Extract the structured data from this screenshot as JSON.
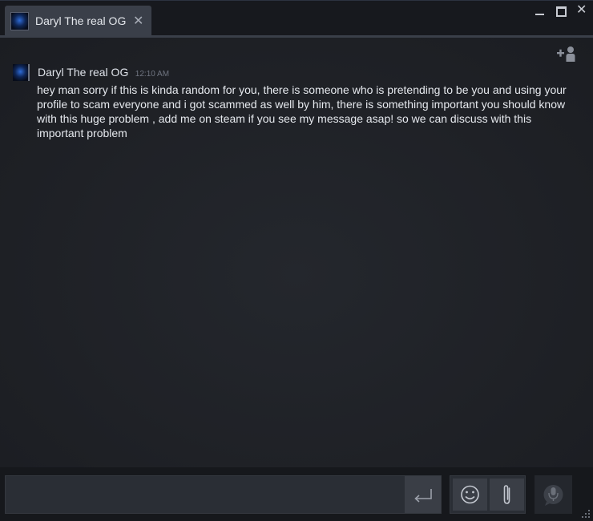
{
  "window": {
    "controls": {
      "minimize_icon": "minimize-icon",
      "maximize_icon": "maximize-icon",
      "close_glyph": "✕"
    }
  },
  "tab": {
    "title": "Daryl The real OG",
    "close_glyph": "✕"
  },
  "messages": [
    {
      "author": "Daryl The real OG",
      "time": "12:10 AM",
      "text": "hey man sorry if this is kinda random for you, there is someone who is pretending to be you and using your profile to scam everyone and i got scammed as well by him, there is something important you should know with this huge problem , add me on steam if you see my message asap! so we can discuss with this important problem"
    }
  ],
  "composer": {
    "value": "",
    "placeholder": ""
  },
  "colors": {
    "background": "#1e2025",
    "titlebar": "#17191e",
    "tab": "#3a3f49",
    "text": "#e6e9ee",
    "timestamp": "#6f7480"
  }
}
